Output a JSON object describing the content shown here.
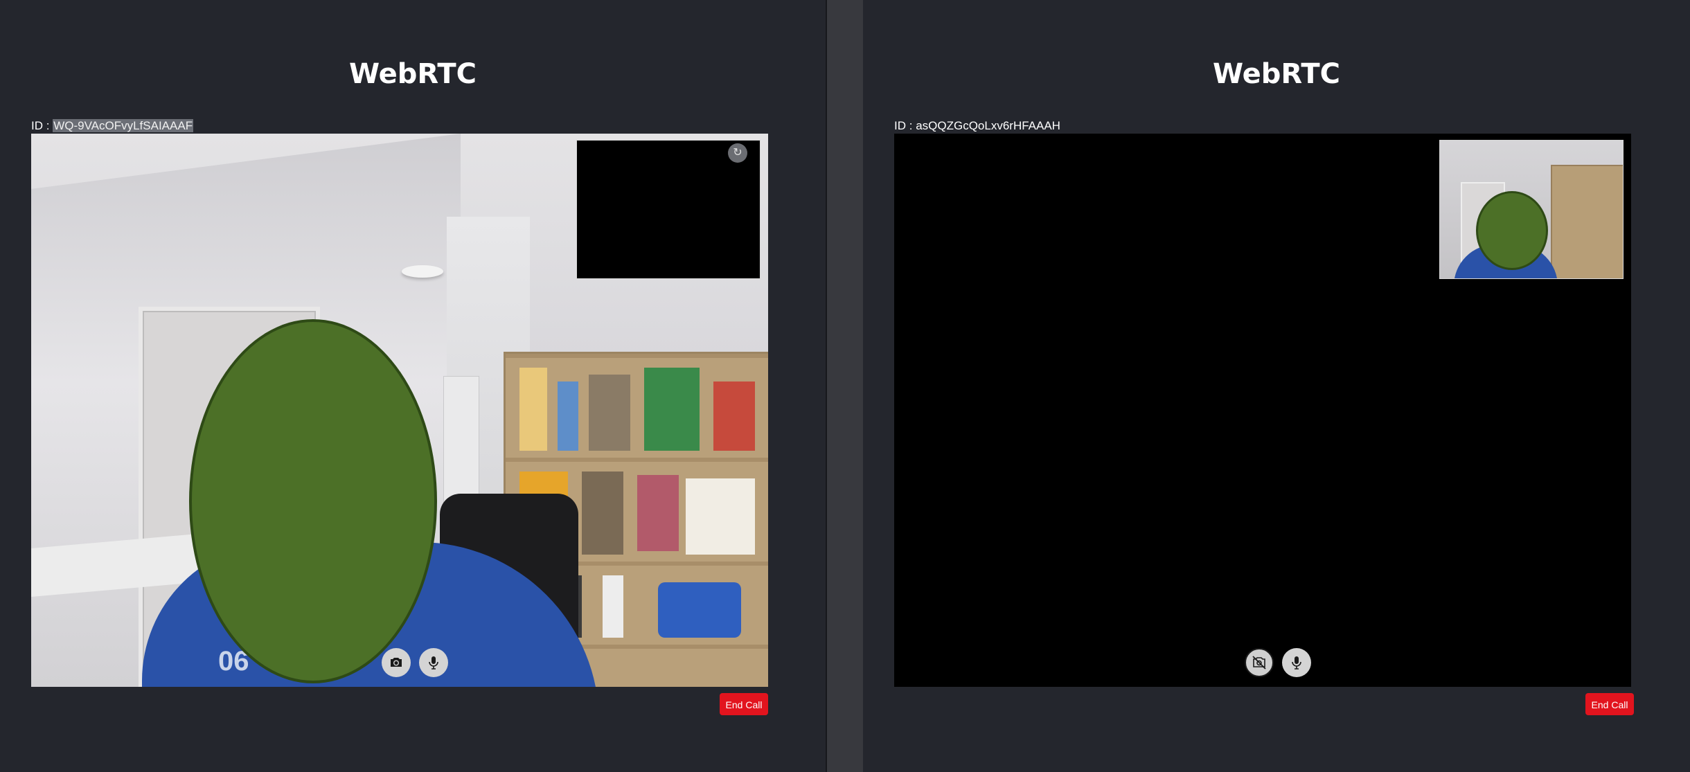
{
  "left": {
    "title": "WebRTC",
    "id_label": "ID :",
    "id_value": "WQ-9VAcOFvyLfSAIAAAF",
    "local_camera": "on",
    "pip_camera": "off",
    "camera_icon": "camera-icon",
    "mic_icon": "mic-icon",
    "pip_icon": "camera-switch-icon",
    "translate_icon": "google-translate-icon",
    "end_call_label": "End Call",
    "shirt_text": "06"
  },
  "right": {
    "title": "WebRTC",
    "id_label": "ID :",
    "id_value": "asQQZGcQoLxv6rHFAAAH",
    "local_camera": "off",
    "pip_camera": "on",
    "camera_icon": "camera-off-icon",
    "mic_icon": "mic-icon",
    "end_call_label": "End Call"
  },
  "colors": {
    "background": "#24262d",
    "divider": "#38393e",
    "end_call": "#e2141e",
    "face_mask": "#4c7027",
    "control_button": "#d4d4d4"
  }
}
